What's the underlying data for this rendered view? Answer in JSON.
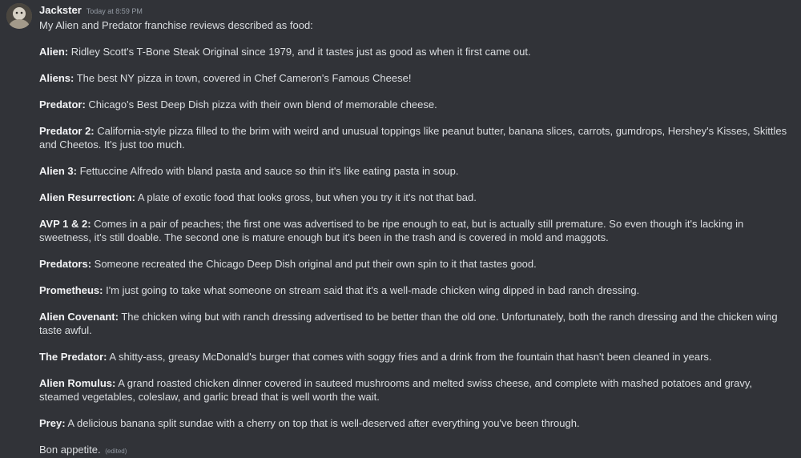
{
  "message": {
    "author": "Jackster",
    "timestamp": "Today at 8:59 PM",
    "intro": "My Alien and Predator franchise reviews described as food:",
    "reviews": [
      {
        "title": "Alien:",
        "text": " Ridley Scott's T-Bone Steak Original since 1979, and it tastes just as good as when it first came out."
      },
      {
        "title": "Aliens:",
        "text": " The best NY pizza in town, covered in Chef Cameron's Famous Cheese!"
      },
      {
        "title": "Predator:",
        "text": " Chicago's Best Deep Dish pizza with their own blend of memorable cheese."
      },
      {
        "title": "Predator 2:",
        "text": " California-style pizza filled to the brim with weird and unusual toppings like peanut butter, banana slices, carrots, gumdrops, Hershey's Kisses, Skittles and Cheetos. It's just too much."
      },
      {
        "title": "Alien 3:",
        "text": " Fettuccine Alfredo with bland pasta and sauce so thin it's like eating pasta in soup."
      },
      {
        "title": "Alien Resurrection:",
        "text": " A plate of exotic food that looks gross, but when you try it it's not that bad."
      },
      {
        "title": "AVP 1 & 2:",
        "text": " Comes in a pair of peaches; the first one was advertised to be ripe enough to eat, but is actually still premature. So even though it's lacking in sweetness, it's still doable. The second one is mature enough but it's been in the trash and is covered in mold and maggots."
      },
      {
        "title": "Predators:",
        "text": " Someone recreated the Chicago Deep Dish original and put their own spin to it that tastes good."
      },
      {
        "title": "Prometheus:",
        "text": " I'm just going to take what someone on stream said that it's a well-made chicken wing dipped in bad ranch dressing."
      },
      {
        "title": "Alien Covenant:",
        "text": " The chicken wing but with ranch dressing advertised to be better than the old one. Unfortunately, both the ranch dressing and the chicken wing taste awful."
      },
      {
        "title": "The Predator:",
        "text": " A shitty-ass, greasy McDonald's burger that comes with soggy fries and a drink from the fountain that hasn't been cleaned in years."
      },
      {
        "title": "Alien Romulus:",
        "text": " A grand roasted chicken dinner covered in sauteed mushrooms and melted swiss cheese, and complete with mashed potatoes and gravy, steamed vegetables, coleslaw, and garlic bread that is well worth the wait."
      },
      {
        "title": "Prey:",
        "text": " A delicious banana split sundae with a cherry on top that is well-deserved after everything you've been through."
      }
    ],
    "closing": "Bon appetite.",
    "edited_label": "(edited)"
  },
  "colors": {
    "background": "#313338",
    "text": "#dbdee1",
    "username": "#f2f3f5",
    "muted": "#949ba4"
  },
  "icons": {
    "avatar": "user-avatar"
  }
}
